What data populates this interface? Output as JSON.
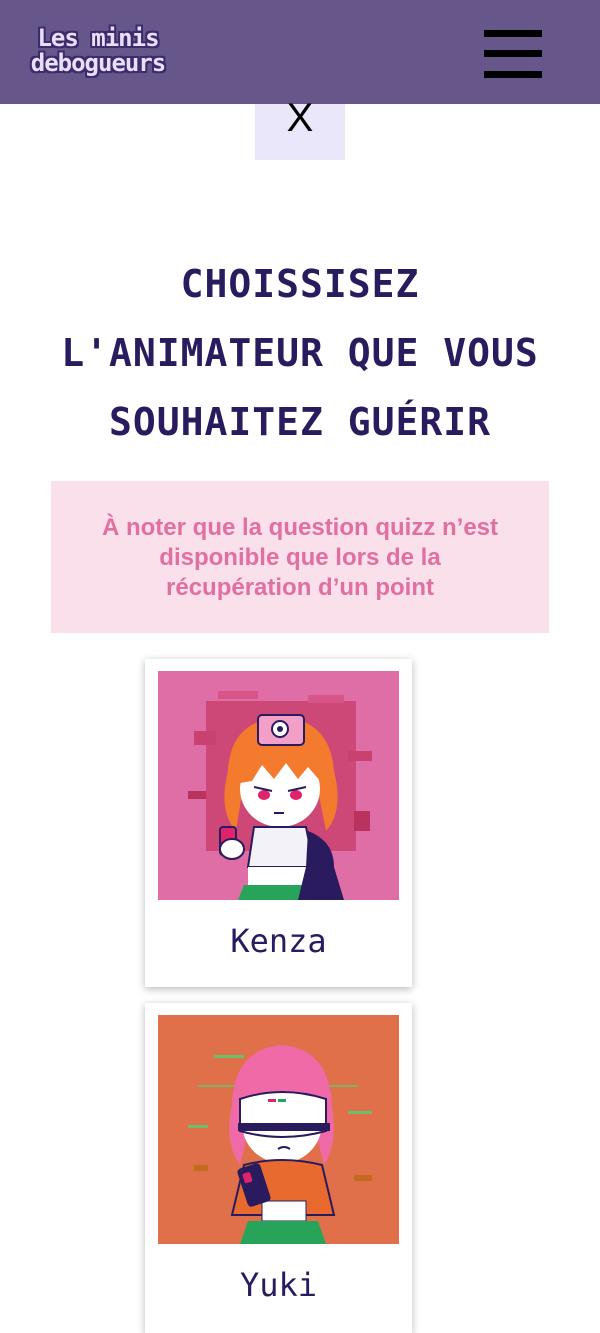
{
  "header": {
    "logo_line1": "Les minis",
    "logo_line2": "debogueurs",
    "menu_icon": "hamburger-menu-icon",
    "background_color": "#67568a"
  },
  "close": {
    "label": "X"
  },
  "main": {
    "title_lines": [
      "CHOISSISEZ",
      "L'ANIMATEUR QUE VOUS",
      "SOUHAITEZ GUÉRIR"
    ],
    "notice_lines": [
      "À noter que la question quizz n’est",
      "disponible que lors de la",
      "récupération d’un point"
    ]
  },
  "animators": [
    {
      "name": "Kenza",
      "image_bg": "#e06ea6"
    },
    {
      "name": "Yuki",
      "image_bg": "#e07049"
    }
  ],
  "colors": {
    "title": "#2a1b5e",
    "notice_bg": "#f9e0ea",
    "notice_text": "#e06fa2",
    "close_bg": "#ebe7fb"
  }
}
